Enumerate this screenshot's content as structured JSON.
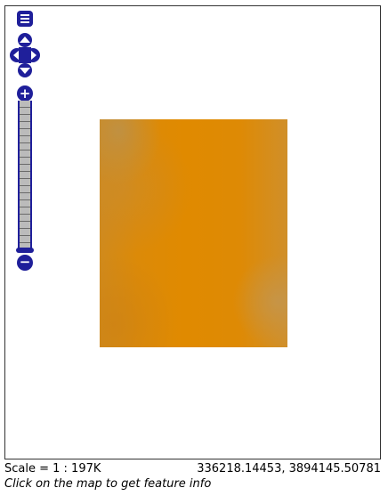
{
  "map": {
    "raster_colors": {
      "primary": "#e08a00",
      "edge": "#c99448"
    }
  },
  "controls": {
    "layer_switcher_icon": "layer-list-icon",
    "pan_icons": [
      "pan-up-icon",
      "pan-left-icon",
      "pan-right-icon",
      "pan-down-icon"
    ],
    "zoom_in_label": "+",
    "zoom_out_label": "−",
    "zoom_level": 0,
    "accent_color": "#1f1f9a"
  },
  "status": {
    "scale_text": "Scale = 1 : 197K",
    "coordinates": "336218.14453, 3894145.50781",
    "info_text": "Click on the map to get feature info"
  }
}
